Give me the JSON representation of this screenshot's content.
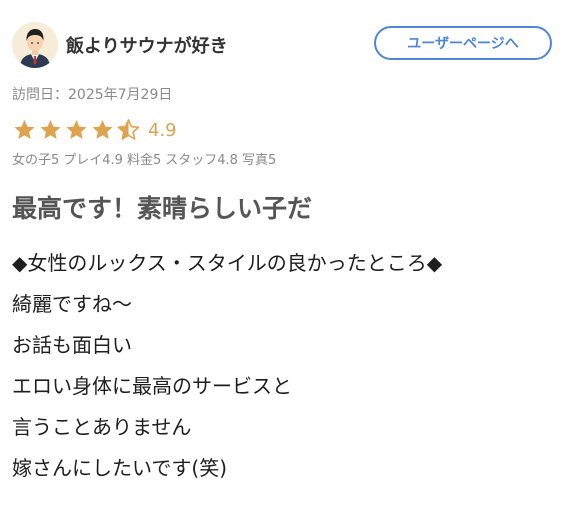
{
  "header": {
    "username": "飯よりサウナが好き",
    "user_page_button": "ユーザーページへ"
  },
  "visit_date": "訪問日：2025年7月29日",
  "rating": {
    "stars_filled": 4.5,
    "stars_total": 5,
    "score": "4.9",
    "star_color": "#dfa24e"
  },
  "subscores": [
    {
      "label": "女の子5"
    },
    {
      "label": "プレイ4.9"
    },
    {
      "label": "料金5"
    },
    {
      "label": "スタッフ4.8"
    },
    {
      "label": "写真5"
    }
  ],
  "review": {
    "title": "最高です！素晴らしい子だ",
    "lines": [
      "◆女性のルックス・スタイルの良かったところ◆",
      "綺麗ですね〜",
      "お話も面白い",
      "エロい身体に最高のサービスと",
      "言うことありません",
      "嫁さんにしたいです(笑)"
    ]
  },
  "colors": {
    "accent_blue": "#4f86d6",
    "muted_text": "#8a8a8a"
  }
}
